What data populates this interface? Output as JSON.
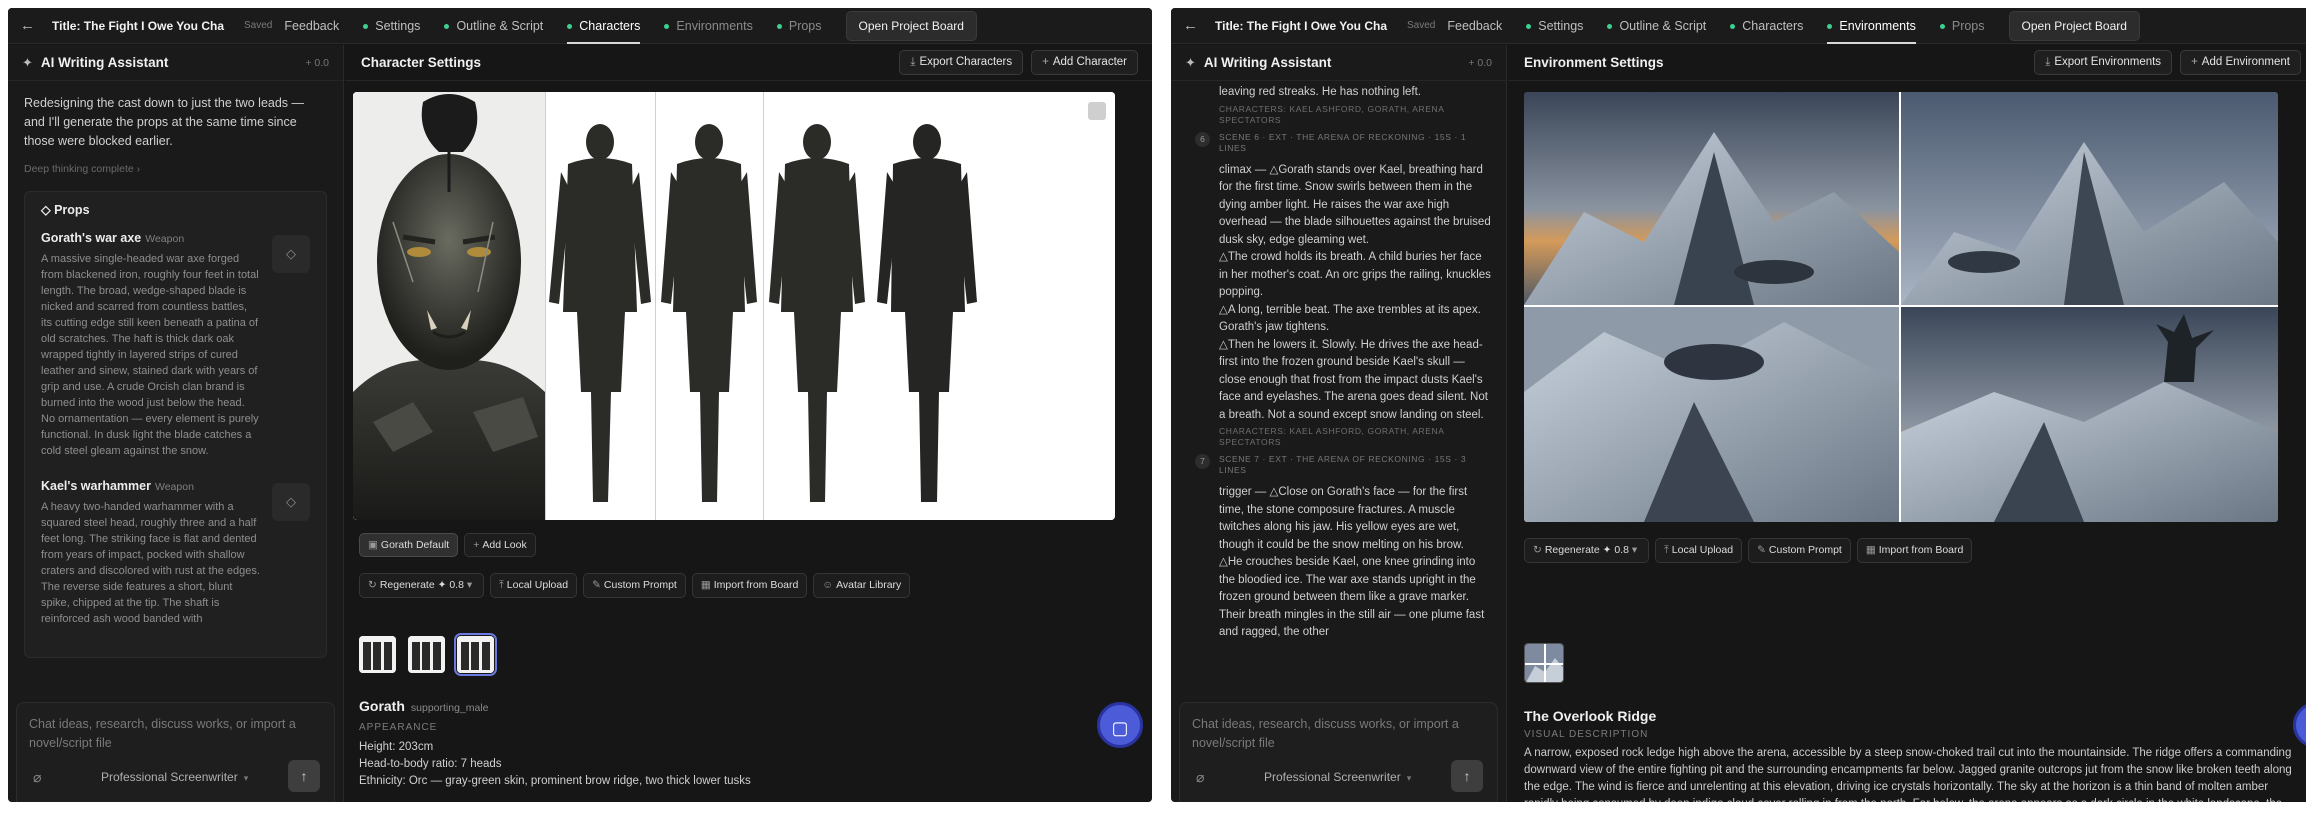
{
  "left": {
    "topbar": {
      "title": "Title: The Fight I Owe You Cha",
      "saved": "Saved",
      "feedback": "Feedback",
      "tabs": [
        "Settings",
        "Outline & Script",
        "Characters",
        "Environments",
        "Props"
      ],
      "active_tab": "Characters",
      "board": "Open Project Board"
    },
    "assistant": {
      "title": "AI Writing Assistant",
      "version": "+ 0.0",
      "message": "Redesigning the cast down to just the two leads — and I'll generate the props at the same time since those were blocked earlier.",
      "thinking": "Deep thinking complete ›",
      "props_title": "Props",
      "props": [
        {
          "name": "Gorath's war axe",
          "type": "Weapon",
          "desc": "A massive single-headed war axe forged from blackened iron, roughly four feet in total length. The broad, wedge-shaped blade is nicked and scarred from countless battles, its cutting edge still keen beneath a patina of old scratches. The haft is thick dark oak wrapped tightly in layered strips of cured leather and sinew, stained dark with years of grip and use. A crude Orcish clan brand is burned into the wood just below the head. No ornamentation — every element is purely functional. In dusk light the blade catches a cold steel gleam against the snow."
        },
        {
          "name": "Kael's warhammer",
          "type": "Weapon",
          "desc": "A heavy two-handed warhammer with a squared steel head, roughly three and a half feet long. The striking face is flat and dented from years of impact, pocked with shallow craters and discolored with rust at the edges. The reverse side features a short, blunt spike, chipped at the tip. The shaft is reinforced ash wood banded with"
        }
      ],
      "composer_placeholder": "Chat ideas, research, discuss works, or import a novel/script file",
      "mode": "Professional Screenwriter"
    },
    "main": {
      "title": "Character Settings",
      "export": "Export Characters",
      "add": "Add Character",
      "look": "Gorath Default",
      "add_look": "Add Look",
      "tools": [
        "Regenerate ✦ 0.8",
        "Local Upload",
        "Custom Prompt",
        "Import from Board",
        "Avatar Library"
      ],
      "char_name": "Gorath",
      "char_role": "supporting_male",
      "appearance_label": "APPEARANCE",
      "appearance": [
        "Height: 203cm",
        "Head-to-body ratio: 7 heads",
        "Ethnicity: Orc — gray-green skin, prominent brow ridge, two thick lower tusks"
      ]
    }
  },
  "right": {
    "topbar": {
      "title": "Title: The Fight I Owe You Cha",
      "saved": "Saved",
      "feedback": "Feedback",
      "tabs": [
        "Settings",
        "Outline & Script",
        "Characters",
        "Environments",
        "Props"
      ],
      "active_tab": "Environments",
      "board": "Open Project Board"
    },
    "assistant": {
      "title": "AI Writing Assistant",
      "version": "+ 0.0",
      "frag1": "leaving red streaks. He has nothing left.",
      "meta1": "CHARACTERS: KAEL ASHFORD, GORATH, ARENA SPECTATORS",
      "scene6_num": "6",
      "scene6": "SCENE 6 · EXT · THE ARENA OF RECKONING · 15S · 1 LINES",
      "scene6_lines": [
        "climax — △Gorath stands over Kael, breathing hard for the first time. Snow swirls between them in the dying amber light. He raises the war axe high overhead — the blade silhouettes against the bruised dusk sky, edge gleaming wet.",
        "△The crowd holds its breath. A child buries her face in her mother's coat. An orc grips the railing, knuckles popping.",
        "△A long, terrible beat. The axe trembles at its apex. Gorath's jaw tightens.",
        "△Then he lowers it. Slowly. He drives the axe head-first into the frozen ground beside Kael's skull — close enough that frost from the impact dusts Kael's face and eyelashes. The arena goes dead silent. Not a breath. Not a sound except snow landing on steel."
      ],
      "meta2": "CHARACTERS: KAEL ASHFORD, GORATH, ARENA SPECTATORS",
      "scene7_num": "7",
      "scene7": "SCENE 7 · EXT · THE ARENA OF RECKONING · 15S · 3 LINES",
      "scene7_lines": [
        "trigger — △Close on Gorath's face — for the first time, the stone composure fractures. A muscle twitches along his jaw. His yellow eyes are wet, though it could be the snow melting on his brow.",
        "△He crouches beside Kael, one knee grinding into the bloodied ice. The war axe stands upright in the frozen ground between them like a grave marker. Their breath mingles in the still air — one plume fast and ragged, the other"
      ],
      "composer_placeholder": "Chat ideas, research, discuss works, or import a novel/script file",
      "mode": "Professional Screenwriter"
    },
    "main": {
      "title": "Environment Settings",
      "export": "Export Environments",
      "add": "Add Environment",
      "tools": [
        "Regenerate ✦ 0.8",
        "Local Upload",
        "Custom Prompt",
        "Import from Board"
      ],
      "env_name": "The Overlook Ridge",
      "visual_label": "VISUAL DESCRIPTION",
      "visual": "A narrow, exposed rock ledge high above the arena, accessible by a steep snow-choked trail cut into the mountainside. The ridge offers a commanding downward view of the entire fighting pit and the surrounding encampments far below. Jagged granite outcrops jut from the snow like broken teeth along the edge. The wind is fierce and unrelenting at this elevation, driving ice crystals horizontally. The sky at the horizon is a thin band of molten amber rapidly being consumed by deep indigo cloud cover rolling in from the north. Far below, the arena appears as a dark circle in the white landscape, the war banners tiny and fluttering. Sparse, twisted pine trees cling to crevices in the rock."
    }
  },
  "icons": {
    "back": "arrow-left-icon",
    "spark": "sparkle-icon",
    "gem": "gem-icon",
    "clip": "paperclip-icon",
    "send": "arrow-up-icon",
    "support": "chat-bubble-icon"
  },
  "colors": {
    "accent_dot": "#3fcf8e",
    "fab": "#4c5bd8"
  }
}
